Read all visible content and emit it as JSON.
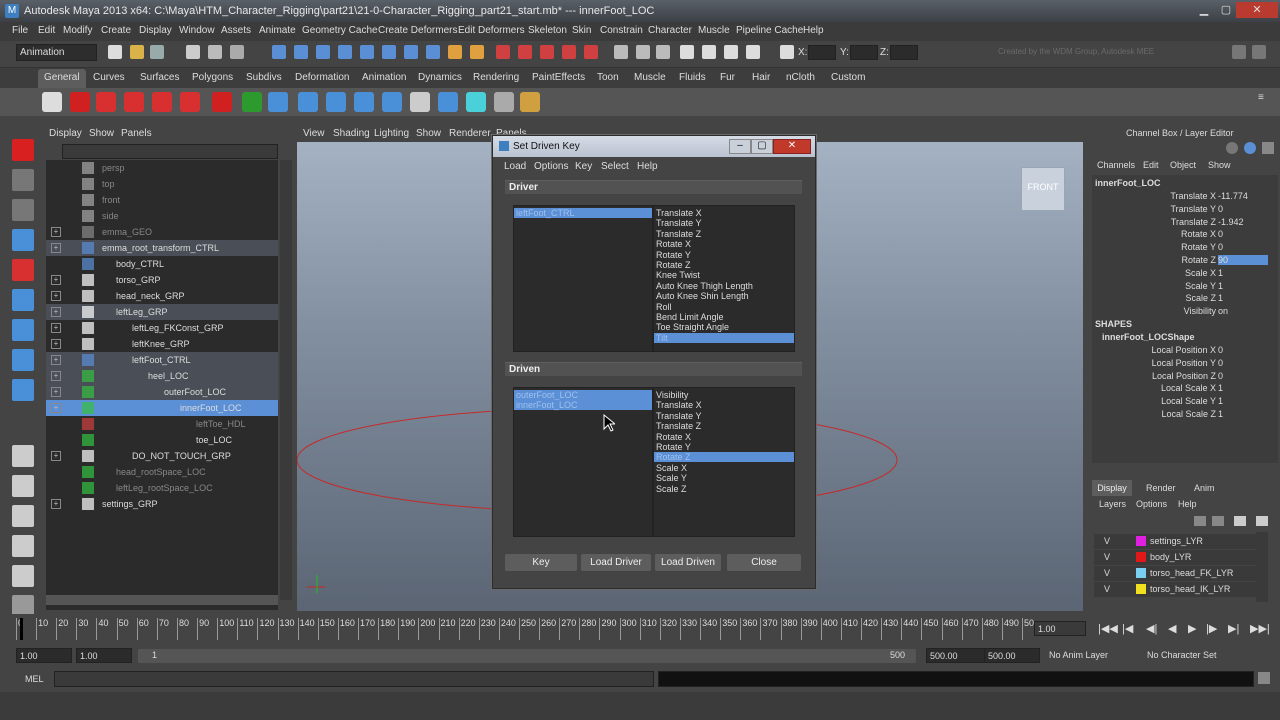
{
  "window": {
    "title": "Autodesk Maya 2013 x64: C:\\Maya\\HTM_Character_Rigging\\part21\\21-0-Character_Rigging_part21_start.mb*   ---   innerFoot_LOC"
  },
  "menubar": [
    "File",
    "Edit",
    "Modify",
    "Create",
    "Display",
    "Window",
    "Assets",
    "Animate",
    "Geometry Cache",
    "Create Deformers",
    "Edit Deformers",
    "Skeleton",
    "Skin",
    "Constrain",
    "Character",
    "Muscle",
    "Pipeline Cache",
    "Help"
  ],
  "toolbar": {
    "mode": "Animation",
    "x_label": "X:",
    "y_label": "Y:",
    "z_label": "Z:",
    "credit": "Created by the WDM Group, Autodesk MEE"
  },
  "shelf_tabs": [
    "General",
    "Curves",
    "Surfaces",
    "Polygons",
    "Subdivs",
    "Deformation",
    "Animation",
    "Dynamics",
    "Rendering",
    "PaintEffects",
    "Toon",
    "Muscle",
    "Fluids",
    "Fur",
    "Hair",
    "nCloth",
    "Custom"
  ],
  "outliner": {
    "menu": [
      "Display",
      "Show",
      "Panels"
    ],
    "rows": [
      {
        "label": "persp",
        "dim": true
      },
      {
        "label": "top",
        "dim": true
      },
      {
        "label": "front",
        "dim": true
      },
      {
        "label": "side",
        "dim": true
      },
      {
        "label": "emma_GEO",
        "dim": true
      },
      {
        "label": "emma_root_transform_CTRL",
        "dim": false
      },
      {
        "label": "body_CTRL",
        "dim": false
      },
      {
        "label": "torso_GRP",
        "dim": false
      },
      {
        "label": "head_neck_GRP",
        "dim": false
      },
      {
        "label": "leftLeg_GRP",
        "dim": false
      },
      {
        "label": "leftLeg_FKConst_GRP",
        "dim": false
      },
      {
        "label": "leftKnee_GRP",
        "dim": false
      },
      {
        "label": "leftFoot_CTRL",
        "dim": false
      },
      {
        "label": "heel_LOC",
        "dim": false
      },
      {
        "label": "outerFoot_LOC",
        "dim": false
      },
      {
        "label": "innerFoot_LOC",
        "dim": false
      },
      {
        "label": "leftToe_HDL",
        "dim": true
      },
      {
        "label": "toe_LOC",
        "dim": false
      },
      {
        "label": "DO_NOT_TOUCH_GRP",
        "dim": false
      },
      {
        "label": "head_rootSpace_LOC",
        "dim": true
      },
      {
        "label": "leftLeg_rootSpace_LOC",
        "dim": true
      },
      {
        "label": "settings_GRP",
        "dim": false
      }
    ]
  },
  "viewport": {
    "menu": [
      "View",
      "Shading",
      "Lighting",
      "Show",
      "Renderer",
      "Panels"
    ],
    "view_cube": "FRONT"
  },
  "dialog": {
    "title": "Set Driven Key",
    "menu": [
      "Load",
      "Options",
      "Key",
      "Select",
      "Help"
    ],
    "driver_label": "Driver",
    "driven_label": "Driven",
    "driver_objects": [
      "leftFoot_CTRL"
    ],
    "driver_attrs": [
      "Translate X",
      "Translate Y",
      "Translate Z",
      "Rotate X",
      "Rotate Y",
      "Rotate Z",
      "Knee Twist",
      "Auto Knee Thigh Length",
      "Auto Knee Shin Length",
      "Roll",
      "Bend Limit Angle",
      "Toe Straight Angle",
      "Tilt"
    ],
    "driven_objects": [
      "outerFoot_LOC",
      "innerFoot_LOC"
    ],
    "driven_attrs": [
      "Visibility",
      "Translate X",
      "Translate Y",
      "Translate Z",
      "Rotate X",
      "Rotate Y",
      "Rotate Z",
      "Scale X",
      "Scale Y",
      "Scale Z"
    ],
    "buttons": {
      "key": "Key",
      "load_driver": "Load Driver",
      "load_driven": "Load Driven",
      "close": "Close"
    }
  },
  "channel_box": {
    "header": "Channel Box / Layer Editor",
    "menu": [
      "Channels",
      "Edit",
      "Object",
      "Show"
    ],
    "object": "innerFoot_LOC",
    "channels": [
      {
        "name": "Translate X",
        "value": "-11.774"
      },
      {
        "name": "Translate Y",
        "value": "0"
      },
      {
        "name": "Translate Z",
        "value": "-1.942"
      },
      {
        "name": "Rotate X",
        "value": "0"
      },
      {
        "name": "Rotate Y",
        "value": "0"
      },
      {
        "name": "Rotate Z",
        "value": "90"
      },
      {
        "name": "Scale X",
        "value": "1"
      },
      {
        "name": "Scale Y",
        "value": "1"
      },
      {
        "name": "Scale Z",
        "value": "1"
      },
      {
        "name": "Visibility",
        "value": "on"
      }
    ],
    "shapes_label": "SHAPES",
    "shape_name": "innerFoot_LOCShape",
    "shape_channels": [
      {
        "name": "Local Position X",
        "value": "0"
      },
      {
        "name": "Local Position Y",
        "value": "0"
      },
      {
        "name": "Local Position Z",
        "value": "0"
      },
      {
        "name": "Local Scale X",
        "value": "1"
      },
      {
        "name": "Local Scale Y",
        "value": "1"
      },
      {
        "name": "Local Scale Z",
        "value": "1"
      }
    ]
  },
  "layer_editor": {
    "tabs": [
      "Display",
      "Render",
      "Anim"
    ],
    "menu": [
      "Layers",
      "Options",
      "Help"
    ],
    "layers": [
      {
        "v": "V",
        "name": "settings_LYR",
        "color": "#e020e0"
      },
      {
        "v": "V",
        "name": "body_LYR",
        "color": "#e01818"
      },
      {
        "v": "V",
        "name": "torso_head_FK_LYR",
        "color": "#7ad0f0"
      },
      {
        "v": "V",
        "name": "torso_head_IK_LYR",
        "color": "#f0e020"
      }
    ]
  },
  "timeline": {
    "ticks": [
      "0",
      "10",
      "20",
      "30",
      "40",
      "50",
      "60",
      "70",
      "80",
      "90",
      "100",
      "110",
      "120",
      "130",
      "140",
      "150",
      "160",
      "170",
      "180",
      "190",
      "200",
      "210",
      "220",
      "230",
      "240",
      "250",
      "260",
      "270",
      "280",
      "290",
      "300",
      "310",
      "320",
      "330",
      "340",
      "350",
      "360",
      "370",
      "380",
      "390",
      "400",
      "410",
      "420",
      "430",
      "440",
      "450",
      "460",
      "470",
      "480",
      "490",
      "50"
    ],
    "current_frame": "1.00"
  },
  "range": {
    "start": "1.00",
    "start2": "1.00",
    "inner_start": "1",
    "inner_end": "500",
    "end": "500.00",
    "end2": "500.00",
    "anim_layer": "No Anim Layer",
    "char_set": "No Character Set"
  },
  "cmd": {
    "label": "MEL"
  }
}
